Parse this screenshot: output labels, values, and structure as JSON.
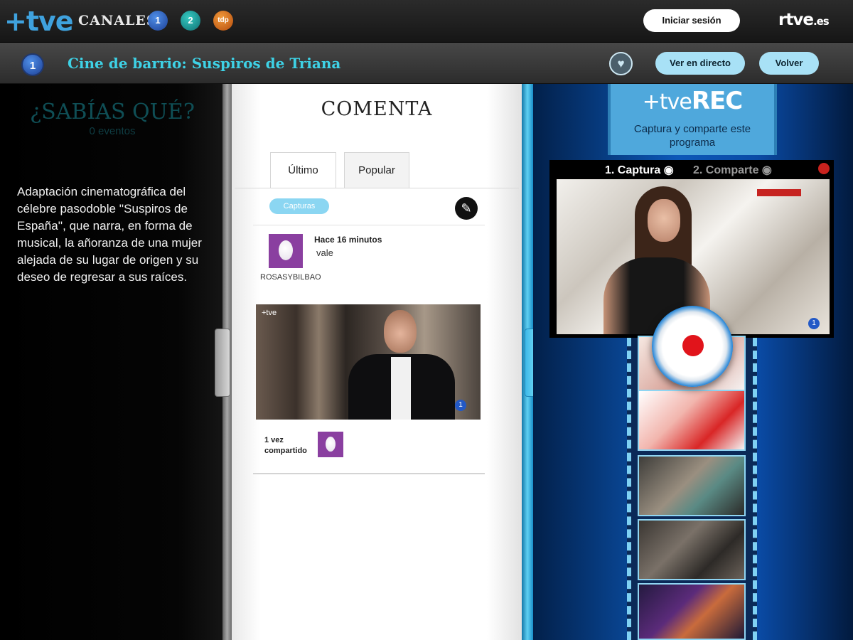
{
  "topbar": {
    "logo": "+tve",
    "canales_label": "CANALES",
    "channels": [
      "1",
      "2",
      "tdp"
    ],
    "login_label": "Iniciar sesión",
    "brand": "rtve",
    "brand_suffix": ".es"
  },
  "subbar": {
    "channel_number": "1",
    "program_title": "Cine de barrio: Suspiros de Triana",
    "favorite_icon": "heart-icon",
    "live_label": "Ver en directo",
    "back_label": "Volver"
  },
  "left_panel": {
    "heading": "¿SABÍAS QUÉ?",
    "events_count": "0 eventos",
    "description": "Adaptación cinematográfica del célebre pasodoble ''Suspiros de España'', que narra, en forma de musical, la añoranza de una mujer alejada de su lugar de origen y su deseo de regresar a sus raíces."
  },
  "comments_panel": {
    "heading": "COMENTA",
    "tabs": [
      "Último",
      "Popular"
    ],
    "filter_label": "Capturas",
    "compose_icon": "pencil-icon",
    "comment": {
      "username": "ROSASYBILBAO",
      "time": "Hace 16 minutos",
      "text": "vale",
      "shared_label": "1 vez compartido",
      "thumbnail_logo": "+tve",
      "thumbnail_channel": "1"
    }
  },
  "rec_panel": {
    "title_plus": "+tve",
    "title_rec": "REC",
    "subtitle": "Captura y comparte este programa",
    "step1": "1. Captura",
    "step2": "2. Comparte",
    "live_channel": "1",
    "record_icon": "record-icon"
  },
  "colors": {
    "accent_cyan": "#3ed2e6",
    "pill_blue": "#a8e1f6",
    "purple_avatar": "#8a3fa0",
    "record_red": "#e1141b"
  }
}
